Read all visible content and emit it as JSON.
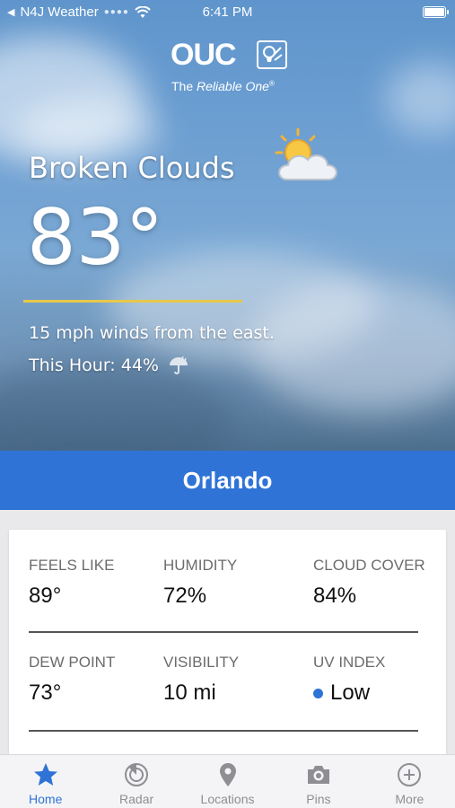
{
  "status_bar": {
    "back_app": "N4J Weather",
    "time": "6:41 PM"
  },
  "logo": {
    "wordmark": "OUC",
    "tagline_prefix": "The ",
    "tagline_emphasis": "Reliable One",
    "tagline_mark": "®"
  },
  "current": {
    "condition": "Broken Clouds",
    "temperature": "83°",
    "winds": "15 mph winds from the east.",
    "this_hour": "This Hour: 44%",
    "weather_icon": "partly-cloudy-icon",
    "precip_icon": "umbrella-rain-icon"
  },
  "location": {
    "city": "Orlando"
  },
  "details": [
    {
      "label": "FEELS LIKE",
      "value": "89°"
    },
    {
      "label": "HUMIDITY",
      "value": "72%"
    },
    {
      "label": "CLOUD COVER",
      "value": "84%"
    },
    {
      "label": "DEW POINT",
      "value": "73°"
    },
    {
      "label": "VISIBILITY",
      "value": "10 mi"
    },
    {
      "label": "UV INDEX",
      "value": "Low"
    }
  ],
  "tabs": [
    {
      "label": "Home",
      "icon": "star-icon",
      "active": true
    },
    {
      "label": "Radar",
      "icon": "radar-icon",
      "active": false
    },
    {
      "label": "Locations",
      "icon": "location-pin-icon",
      "active": false
    },
    {
      "label": "Pins",
      "icon": "camera-icon",
      "active": false
    },
    {
      "label": "More",
      "icon": "plus-circle-icon",
      "active": false
    }
  ],
  "colors": {
    "accent": "#2f73d6",
    "temperature_underline": "#e6c84a",
    "uv_low": "#2f73d6"
  }
}
